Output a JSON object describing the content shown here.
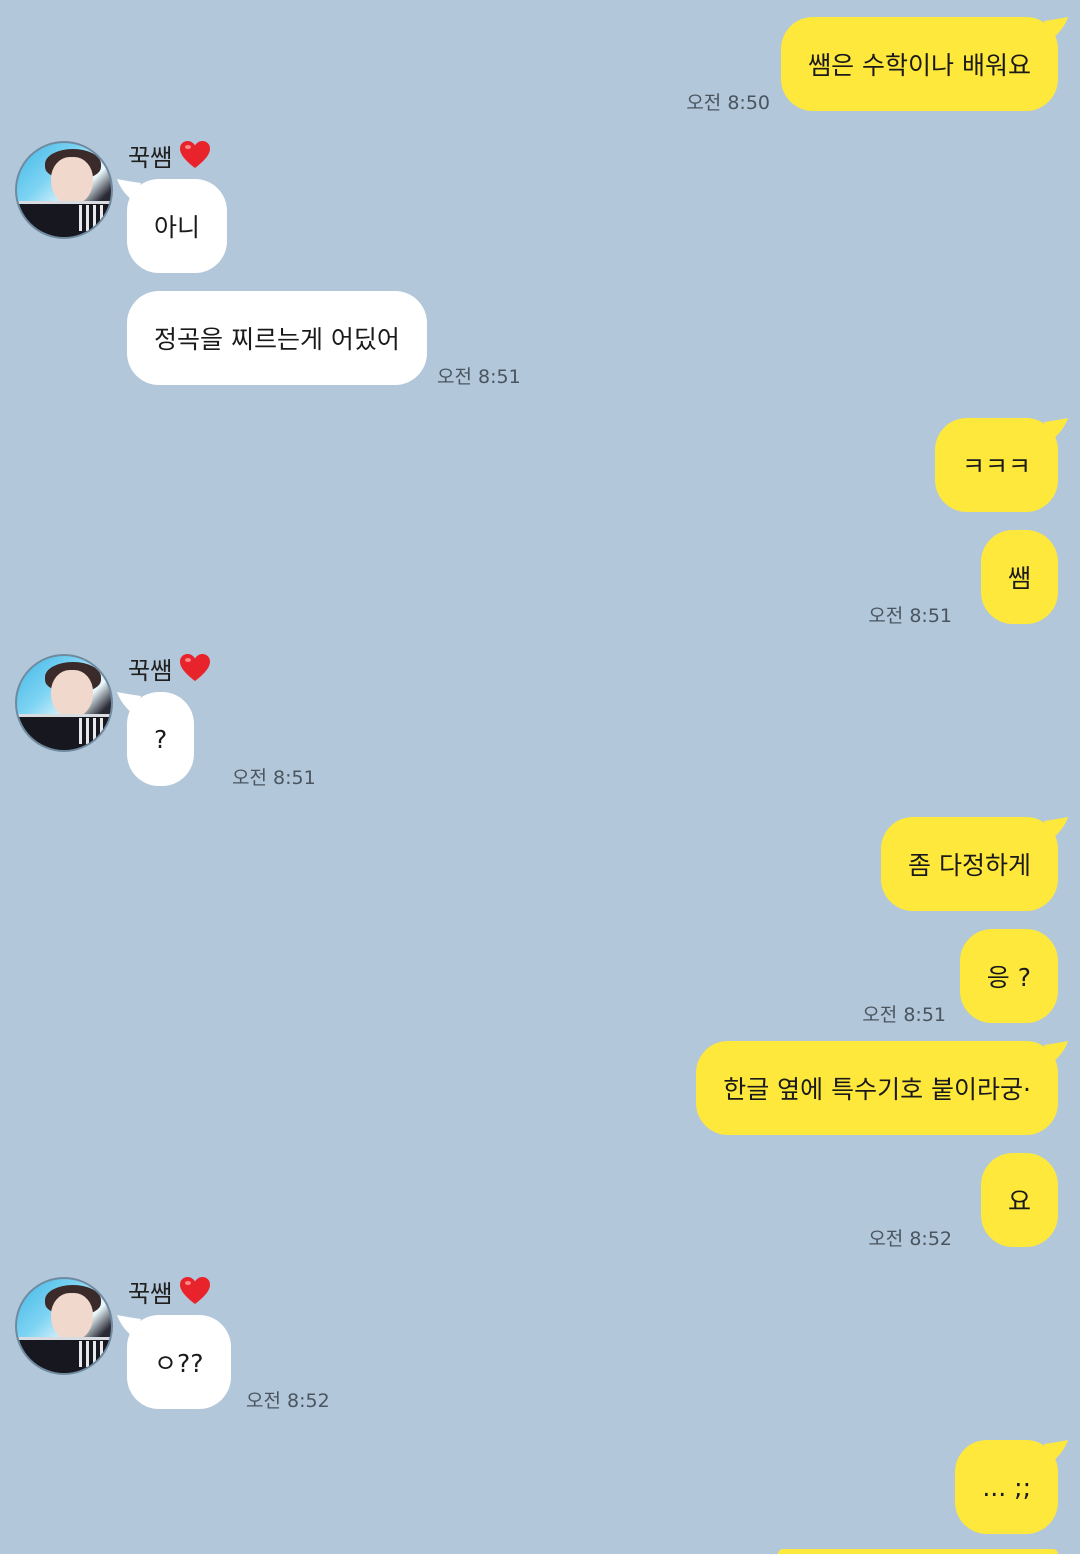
{
  "contact": {
    "name": "꾹쌤",
    "heart_icon": "heart-icon",
    "avatar_icon": "profile-photo"
  },
  "colors": {
    "background": "#b2c7d9",
    "outgoing_bubble": "#fee83b",
    "incoming_bubble": "#ffffff"
  },
  "messages": [
    {
      "text": "쌤은 수학이나 배워요",
      "time": "오전 8:50"
    },
    {
      "text": "아니"
    },
    {
      "text": "정곡을 찌르는게 어딨어",
      "time": "오전 8:51"
    },
    {
      "text": "ㅋㅋㅋ"
    },
    {
      "text": "쌤",
      "time": "오전 8:51"
    },
    {
      "text": "?",
      "time": "오전 8:51"
    },
    {
      "text": "좀 다정하게"
    },
    {
      "text": "응 ?",
      "time": "오전 8:51"
    },
    {
      "text": "한글 옆에 특수기호 붙이라궁·"
    },
    {
      "text": "요",
      "time": "오전 8:52"
    },
    {
      "text": "ㅇ??",
      "time": "오전 8:52"
    },
    {
      "text": "... ;;"
    }
  ]
}
